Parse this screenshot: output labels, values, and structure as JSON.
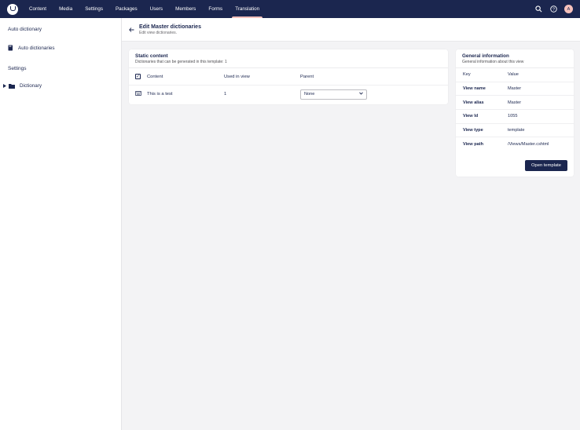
{
  "nav": {
    "items": [
      "Content",
      "Media",
      "Settings",
      "Packages",
      "Users",
      "Members",
      "Forms",
      "Translation"
    ],
    "active": "Translation",
    "avatar_initial": "A"
  },
  "sidebar": {
    "section1": "Auto dictionary",
    "item1": "Auto dictionaries",
    "section2": "Settings",
    "item2": "Dictionary"
  },
  "header": {
    "title": "Edit Master dictionaries",
    "subtitle": "Edit view dictionaries."
  },
  "static_content": {
    "title": "Static content",
    "description": "Dictionaries that can be generated in this template: 1",
    "columns": [
      "Content",
      "Used in view",
      "Parent"
    ],
    "rows": [
      {
        "content": "This is a test",
        "used_in_view": "1",
        "parent": "None"
      }
    ]
  },
  "general_info": {
    "title": "General information",
    "description": "General information about this view",
    "key_header": "Key",
    "value_header": "Value",
    "rows": [
      {
        "key": "View name",
        "value": "Master"
      },
      {
        "key": "View alias",
        "value": "Master"
      },
      {
        "key": "View Id",
        "value": "1055"
      },
      {
        "key": "View type",
        "value": "template"
      },
      {
        "key": "View path",
        "value": "/Views/Master.cshtml"
      }
    ],
    "button": "Open template"
  },
  "colors": {
    "primary": "#1b264f",
    "accent": "#f5c1bc",
    "background": "#f3f3f5"
  }
}
